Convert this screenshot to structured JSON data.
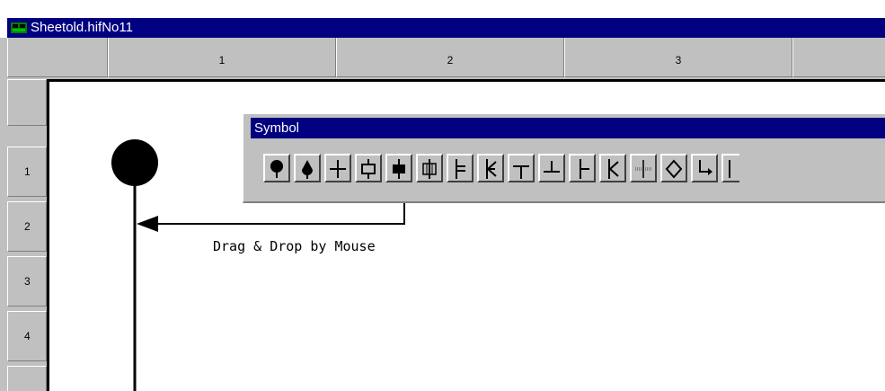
{
  "window": {
    "title": "Sheetold.hifNo11",
    "app_icon": "sheet-app-icon"
  },
  "columns": [
    "1",
    "2",
    "3",
    ""
  ],
  "rows": [
    "1",
    "2",
    "3",
    "4",
    ""
  ],
  "palette": {
    "title": "Symbol",
    "tools": [
      "filled-pin-icon",
      "filled-drop-icon",
      "plus-icon",
      "hollow-connector-icon",
      "filled-connector-icon",
      "double-connector-icon",
      "branch-right-icon",
      "branch-arrow-icon",
      "tee-down-icon",
      "tee-up-icon",
      "tee-right-icon",
      "k-branch-icon",
      "dotted-gap-icon",
      "diamond-icon",
      "corner-arrow-icon",
      "partial-icon"
    ]
  },
  "canvas": {
    "annotation": "Drag & Drop by Mouse",
    "accent": "#000000"
  },
  "colors": {
    "title_bar": "#000080",
    "chrome": "#c0c0c0"
  }
}
